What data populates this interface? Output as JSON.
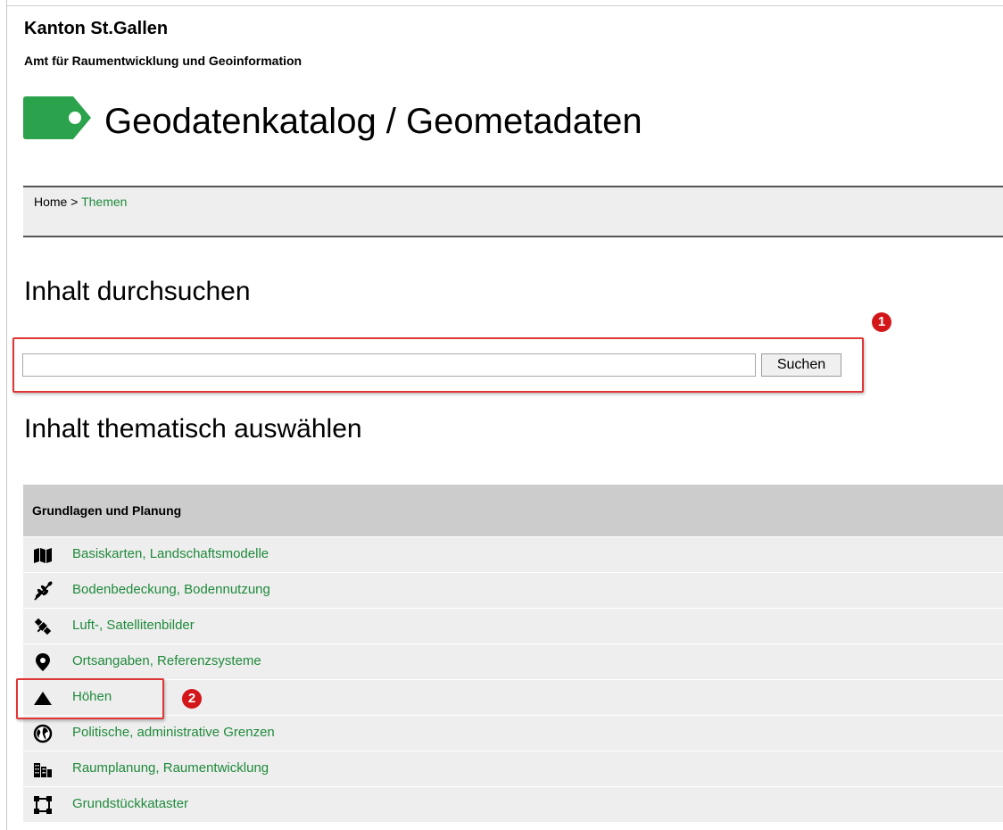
{
  "header": {
    "organization": "Kanton St.Gallen",
    "department": "Amt für Raumentwicklung und Geoinformation",
    "page_title": "Geodatenkatalog / Geometadaten",
    "logo_color": "#2ba24c"
  },
  "breadcrumb": {
    "home": "Home",
    "separator": ">",
    "current": "Themen"
  },
  "search": {
    "heading": "Inhalt durchsuchen",
    "input_value": "",
    "button_label": "Suchen",
    "annotation": "1"
  },
  "themes": {
    "heading": "Inhalt thematisch auswählen",
    "category": "Grundlagen und Planung",
    "items": [
      {
        "label": "Basiskarten, Landschaftsmodelle",
        "icon": "map-icon"
      },
      {
        "label": "Bodenbedeckung, Bodennutzung",
        "icon": "leaf-icon"
      },
      {
        "label": "Luft-, Satellitenbilder",
        "icon": "satellite-icon"
      },
      {
        "label": "Ortsangaben, Referenzsysteme",
        "icon": "map-marker-icon"
      },
      {
        "label": "Höhen",
        "icon": "mountain-icon"
      },
      {
        "label": "Politische, administrative Grenzen",
        "icon": "globe-icon"
      },
      {
        "label": "Raumplanung, Raumentwicklung",
        "icon": "buildings-icon"
      },
      {
        "label": "Grundstückkataster",
        "icon": "parcel-icon"
      }
    ],
    "annotation": "2"
  },
  "colors": {
    "link": "#1f8a3b",
    "highlight": "#e03535",
    "badge": "#d3161a"
  }
}
